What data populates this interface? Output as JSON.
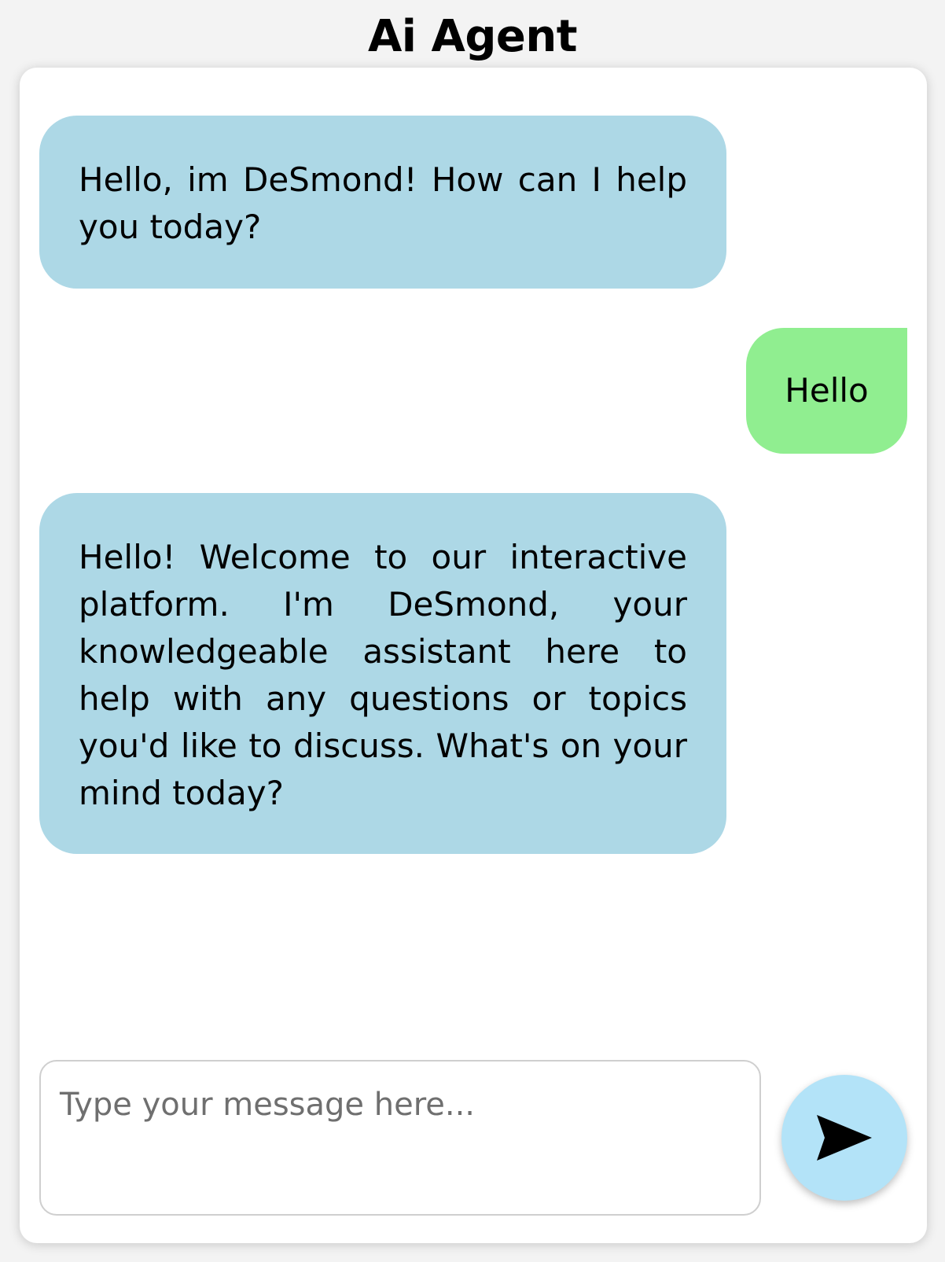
{
  "header": {
    "title": "Ai Agent"
  },
  "chat": {
    "messages": [
      {
        "sender": "bot",
        "text": "Hello, im DeSmond! How can I help you today?"
      },
      {
        "sender": "user",
        "text": "Hello"
      },
      {
        "sender": "bot",
        "text": "Hello! Welcome to our interactive platform. I'm DeSmond, your knowledgeable assistant here to help with any questions or topics you'd like to discuss. What's on your mind today?"
      }
    ]
  },
  "composer": {
    "placeholder": "Type your message here...",
    "value": "",
    "send_icon": "send-icon"
  },
  "colors": {
    "bot_bubble": "#add8e6",
    "user_bubble": "#90ee90",
    "send_button": "#b3e3f8"
  }
}
